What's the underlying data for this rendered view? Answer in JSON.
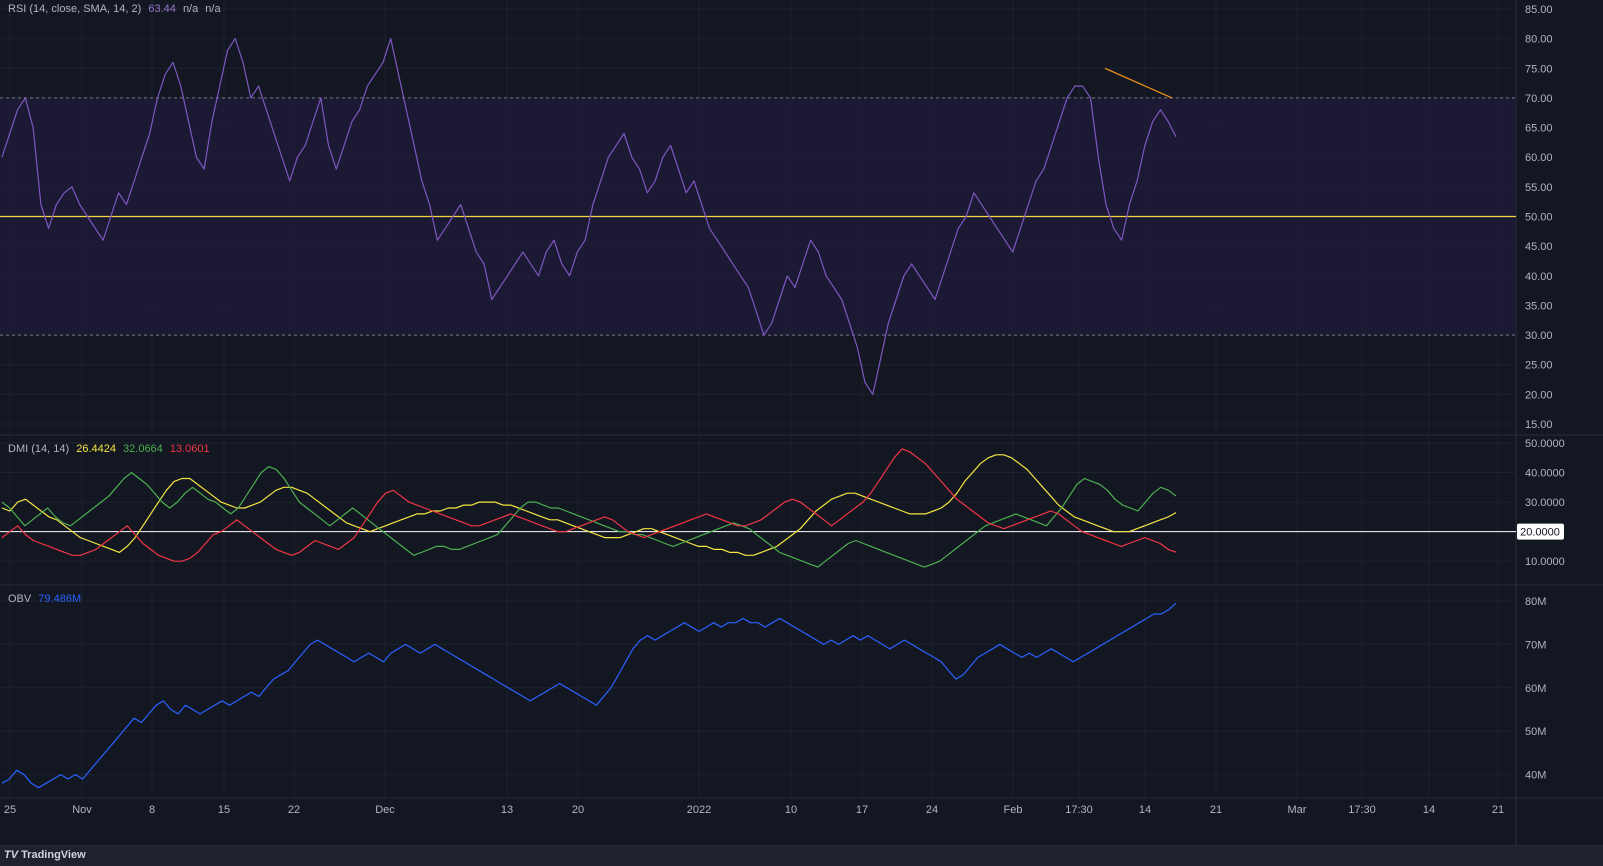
{
  "footer": {
    "brand": "TradingView",
    "brand_mark": "TV"
  },
  "x_axis": {
    "labels": [
      "25",
      "Nov",
      "8",
      "15",
      "22",
      "Dec",
      "13",
      "20",
      "2022",
      "10",
      "17",
      "24",
      "Feb",
      "17:30",
      "14",
      "21",
      "Mar",
      "17:30",
      "14",
      "21"
    ]
  },
  "colors": {
    "background": "#131722",
    "rsi_line": "#7e57c2",
    "rsi_band": "#1f1a37",
    "midline": "#f6d743",
    "divergence": "#f7931a",
    "dmi_adx": "#f5e642",
    "dmi_plus": "#4caf50",
    "dmi_minus": "#f23645",
    "obv_line": "#2962ff",
    "grid": "#1e222d",
    "text": "#b2b5be"
  },
  "chart_data": [
    {
      "type": "line",
      "indicator_label": "RSI (14, close, SMA, 14, 2)",
      "value_text": "63.44",
      "extra_text": [
        "n/a",
        "n/a"
      ],
      "ylim": [
        15,
        85
      ],
      "y_ticks": [
        "85.00",
        "80.00",
        "75.00",
        "70.00",
        "65.00",
        "60.00",
        "55.00",
        "50.00",
        "45.00",
        "40.00",
        "35.00",
        "30.00",
        "25.00",
        "20.00",
        "15.00"
      ],
      "levels": {
        "upper": 70,
        "middle": 50,
        "lower": 30
      },
      "divergence": {
        "from": 75,
        "to": 70
      },
      "series": [
        {
          "values": [
            60,
            64,
            68,
            70,
            65,
            52,
            48,
            52,
            54,
            55,
            52,
            50,
            48,
            46,
            50,
            54,
            52,
            56,
            60,
            64,
            70,
            74,
            76,
            72,
            66,
            60,
            58,
            66,
            72,
            78,
            80,
            76,
            70,
            72,
            68,
            64,
            60,
            56,
            60,
            62,
            66,
            70,
            62,
            58,
            62,
            66,
            68,
            72,
            74,
            76,
            80,
            74,
            68,
            62,
            56,
            52,
            46,
            48,
            50,
            52,
            48,
            44,
            42,
            36,
            38,
            40,
            42,
            44,
            42,
            40,
            44,
            46,
            42,
            40,
            44,
            46,
            52,
            56,
            60,
            62,
            64,
            60,
            58,
            54,
            56,
            60,
            62,
            58,
            54,
            56,
            52,
            48,
            46,
            44,
            42,
            40,
            38,
            34,
            30,
            32,
            36,
            40,
            38,
            42,
            46,
            44,
            40,
            38,
            36,
            32,
            28,
            22,
            20,
            26,
            32,
            36,
            40,
            42,
            40,
            38,
            36,
            40,
            44,
            48,
            50,
            54,
            52,
            50,
            48,
            46,
            44,
            48,
            52,
            56,
            58,
            62,
            66,
            70,
            72,
            72,
            70,
            60,
            52,
            48,
            46,
            52,
            56,
            62,
            66,
            68,
            66,
            63.44
          ]
        }
      ]
    },
    {
      "type": "line",
      "indicator_label": "DMI (14, 14)",
      "value_texts": [
        "26.4424",
        "32.0664",
        "13.0601"
      ],
      "ylim": [
        5,
        50
      ],
      "y_ticks": [
        "50.0000",
        "40.0000",
        "30.0000",
        "20.0000",
        "10.0000"
      ],
      "reference_level": 20,
      "reference_label": "20.0000",
      "series": [
        {
          "name": "ADX",
          "values": [
            28,
            27,
            30,
            31,
            29,
            27,
            25,
            24,
            22,
            20,
            18,
            17,
            16,
            15,
            14,
            13,
            15,
            18,
            22,
            26,
            30,
            34,
            37,
            38,
            38,
            36,
            34,
            32,
            30,
            29,
            28,
            28,
            29,
            30,
            32,
            34,
            35,
            35,
            34,
            33,
            31,
            29,
            27,
            25,
            23,
            22,
            21,
            20,
            21,
            22,
            23,
            24,
            25,
            26,
            26,
            27,
            27,
            28,
            28,
            29,
            29,
            30,
            30,
            30,
            29,
            29,
            28,
            27,
            26,
            25,
            24,
            24,
            23,
            22,
            21,
            20,
            19,
            18,
            18,
            18,
            19,
            20,
            21,
            21,
            20,
            19,
            18,
            17,
            16,
            15,
            15,
            14,
            14,
            13,
            13,
            12,
            12,
            13,
            14,
            15,
            17,
            19,
            21,
            24,
            27,
            29,
            31,
            32,
            33,
            33,
            32,
            31,
            30,
            29,
            28,
            27,
            26,
            26,
            26,
            27,
            28,
            30,
            33,
            37,
            40,
            43,
            45,
            46,
            46,
            45,
            43,
            41,
            38,
            35,
            32,
            29,
            27,
            25,
            24,
            23,
            22,
            21,
            20,
            20,
            20,
            21,
            22,
            23,
            24,
            25,
            26.44
          ]
        },
        {
          "name": "+DI",
          "values": [
            30,
            28,
            25,
            22,
            24,
            26,
            28,
            25,
            23,
            22,
            24,
            26,
            28,
            30,
            32,
            35,
            38,
            40,
            38,
            36,
            33,
            30,
            28,
            30,
            33,
            35,
            33,
            31,
            30,
            28,
            26,
            28,
            32,
            36,
            40,
            42,
            41,
            38,
            34,
            30,
            28,
            26,
            24,
            22,
            24,
            26,
            28,
            26,
            24,
            22,
            20,
            18,
            16,
            14,
            12,
            13,
            14,
            15,
            15,
            14,
            14,
            15,
            16,
            17,
            18,
            19,
            22,
            25,
            28,
            30,
            30,
            29,
            28,
            28,
            27,
            26,
            25,
            24,
            23,
            22,
            21,
            20,
            20,
            19,
            19,
            18,
            17,
            16,
            15,
            16,
            17,
            18,
            19,
            20,
            21,
            22,
            23,
            22,
            21,
            19,
            17,
            15,
            13,
            12,
            11,
            10,
            9,
            8,
            10,
            12,
            14,
            16,
            17,
            16,
            15,
            14,
            13,
            12,
            11,
            10,
            9,
            8,
            9,
            10,
            12,
            14,
            16,
            18,
            20,
            22,
            23,
            24,
            25,
            26,
            25,
            24,
            23,
            22,
            25,
            28,
            32,
            36,
            38,
            37,
            36,
            34,
            31,
            29,
            28,
            27,
            30,
            33,
            35,
            34,
            32.07
          ]
        },
        {
          "name": "-DI",
          "values": [
            18,
            20,
            22,
            19,
            17,
            16,
            15,
            14,
            13,
            12,
            12,
            13,
            14,
            16,
            18,
            20,
            22,
            19,
            16,
            14,
            12,
            11,
            10,
            10,
            11,
            13,
            16,
            19,
            20,
            22,
            24,
            22,
            20,
            18,
            16,
            14,
            13,
            12,
            13,
            15,
            17,
            16,
            15,
            14,
            16,
            18,
            22,
            26,
            30,
            33,
            34,
            32,
            30,
            29,
            28,
            27,
            26,
            25,
            24,
            23,
            22,
            22,
            23,
            24,
            25,
            26,
            25,
            24,
            23,
            22,
            21,
            20,
            20,
            21,
            22,
            23,
            24,
            25,
            24,
            22,
            20,
            19,
            18,
            19,
            20,
            21,
            22,
            23,
            24,
            25,
            26,
            25,
            24,
            23,
            22,
            22,
            23,
            24,
            26,
            28,
            30,
            31,
            30,
            28,
            26,
            24,
            22,
            24,
            26,
            28,
            30,
            33,
            37,
            41,
            45,
            48,
            47,
            45,
            43,
            40,
            37,
            34,
            31,
            29,
            27,
            25,
            23,
            22,
            21,
            22,
            23,
            24,
            25,
            26,
            27,
            26,
            24,
            22,
            20,
            19,
            18,
            17,
            16,
            15,
            16,
            17,
            18,
            17,
            16,
            14,
            13.06
          ]
        }
      ]
    },
    {
      "type": "line",
      "indicator_label": "OBV",
      "value_text": "79.486M",
      "ylim": [
        36,
        83
      ],
      "y_ticks": [
        "80M",
        "70M",
        "60M",
        "50M",
        "40M"
      ],
      "series": [
        {
          "values": [
            38,
            39,
            41,
            40,
            38,
            37,
            38,
            39,
            40,
            39,
            40,
            39,
            41,
            43,
            45,
            47,
            49,
            51,
            53,
            52,
            54,
            56,
            57,
            55,
            54,
            56,
            55,
            54,
            55,
            56,
            57,
            56,
            57,
            58,
            59,
            58,
            60,
            62,
            63,
            64,
            66,
            68,
            70,
            71,
            70,
            69,
            68,
            67,
            66,
            67,
            68,
            67,
            66,
            68,
            69,
            70,
            69,
            68,
            69,
            70,
            69,
            68,
            67,
            66,
            65,
            64,
            63,
            62,
            61,
            60,
            59,
            58,
            57,
            58,
            59,
            60,
            61,
            60,
            59,
            58,
            57,
            56,
            58,
            60,
            63,
            66,
            69,
            71,
            72,
            71,
            72,
            73,
            74,
            75,
            74,
            73,
            74,
            75,
            74,
            75,
            75,
            76,
            75,
            75,
            74,
            75,
            76,
            75,
            74,
            73,
            72,
            71,
            70,
            71,
            70,
            71,
            72,
            71,
            72,
            71,
            70,
            69,
            70,
            71,
            70,
            69,
            68,
            67,
            66,
            64,
            62,
            63,
            65,
            67,
            68,
            69,
            70,
            69,
            68,
            67,
            68,
            67,
            68,
            69,
            68,
            67,
            66,
            67,
            68,
            69,
            70,
            71,
            72,
            73,
            74,
            75,
            76,
            77,
            77,
            78,
            79.49
          ]
        }
      ]
    }
  ]
}
